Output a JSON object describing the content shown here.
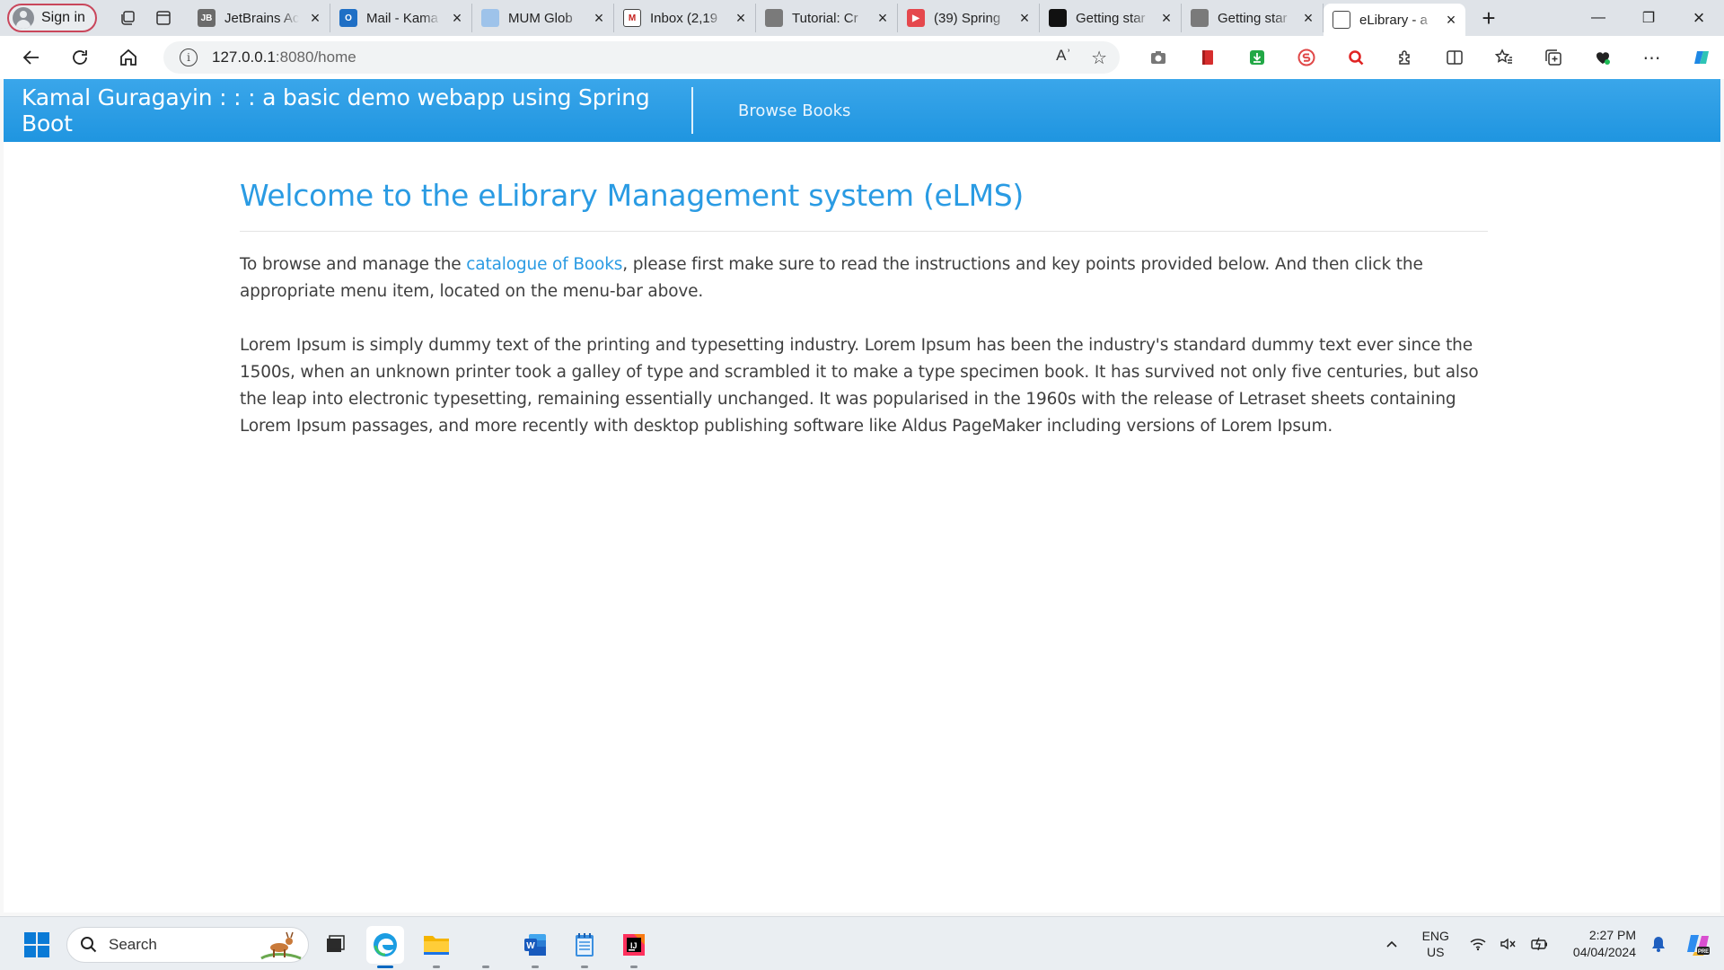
{
  "browser": {
    "signin_label": "Sign in",
    "tabs": [
      {
        "title": "JetBrains Ac",
        "fav_text": "JB",
        "fav_color": "#6b6b6b"
      },
      {
        "title": "Mail - Kama",
        "fav_text": "O",
        "fav_color": "#1f6fc5"
      },
      {
        "title": "MUM Glob",
        "fav_text": "",
        "fav_color": "#9ec3ea"
      },
      {
        "title": "Inbox (2,19",
        "fav_text": "M",
        "fav_color": "#ffffff"
      },
      {
        "title": "Tutorial: Cr",
        "fav_text": "",
        "fav_color": "#7a7a7a"
      },
      {
        "title": "(39) Spring",
        "fav_text": "▶",
        "fav_color": "#e5484d"
      },
      {
        "title": "Getting star",
        "fav_text": "",
        "fav_color": "#111111"
      },
      {
        "title": "Getting star",
        "fav_text": "",
        "fav_color": "#7a7a7a"
      },
      {
        "title": "eLibrary - a",
        "fav_text": "",
        "fav_color": "#ffffff"
      }
    ],
    "url_host": "127.0.0.1",
    "url_path": ":8080/home",
    "read_aloud_glyph": "Aʾ"
  },
  "app": {
    "brand": "Kamal Guragayin : : : a basic demo webapp using Spring Boot",
    "nav_link": "Browse Books"
  },
  "page": {
    "heading": "Welcome to the eLibrary Management system (eLMS)",
    "intro_before": "To browse and manage the ",
    "intro_link": "catalogue of Books",
    "intro_after": ", please first make sure to read the instructions and key points provided below. And then click the appropriate menu item, located on the menu-bar above.",
    "lorem": "Lorem Ipsum is simply dummy text of the printing and typesetting industry. Lorem Ipsum has been the industry's standard dummy text ever since the 1500s, when an unknown printer took a galley of type and scrambled it to make a type specimen book. It has survived not only five centuries, but also the leap into electronic typesetting, remaining essentially unchanged. It was popularised in the 1960s with the release of Letraset sheets containing Lorem Ipsum passages, and more recently with desktop publishing software like Aldus PageMaker including versions of Lorem Ipsum."
  },
  "taskbar": {
    "search_placeholder": "Search",
    "lang_line1": "ENG",
    "lang_line2": "US",
    "time": "2:27 PM",
    "date": "04/04/2024"
  },
  "colors": {
    "accent": "#2a9be3",
    "navbar": "#1f95e0"
  }
}
